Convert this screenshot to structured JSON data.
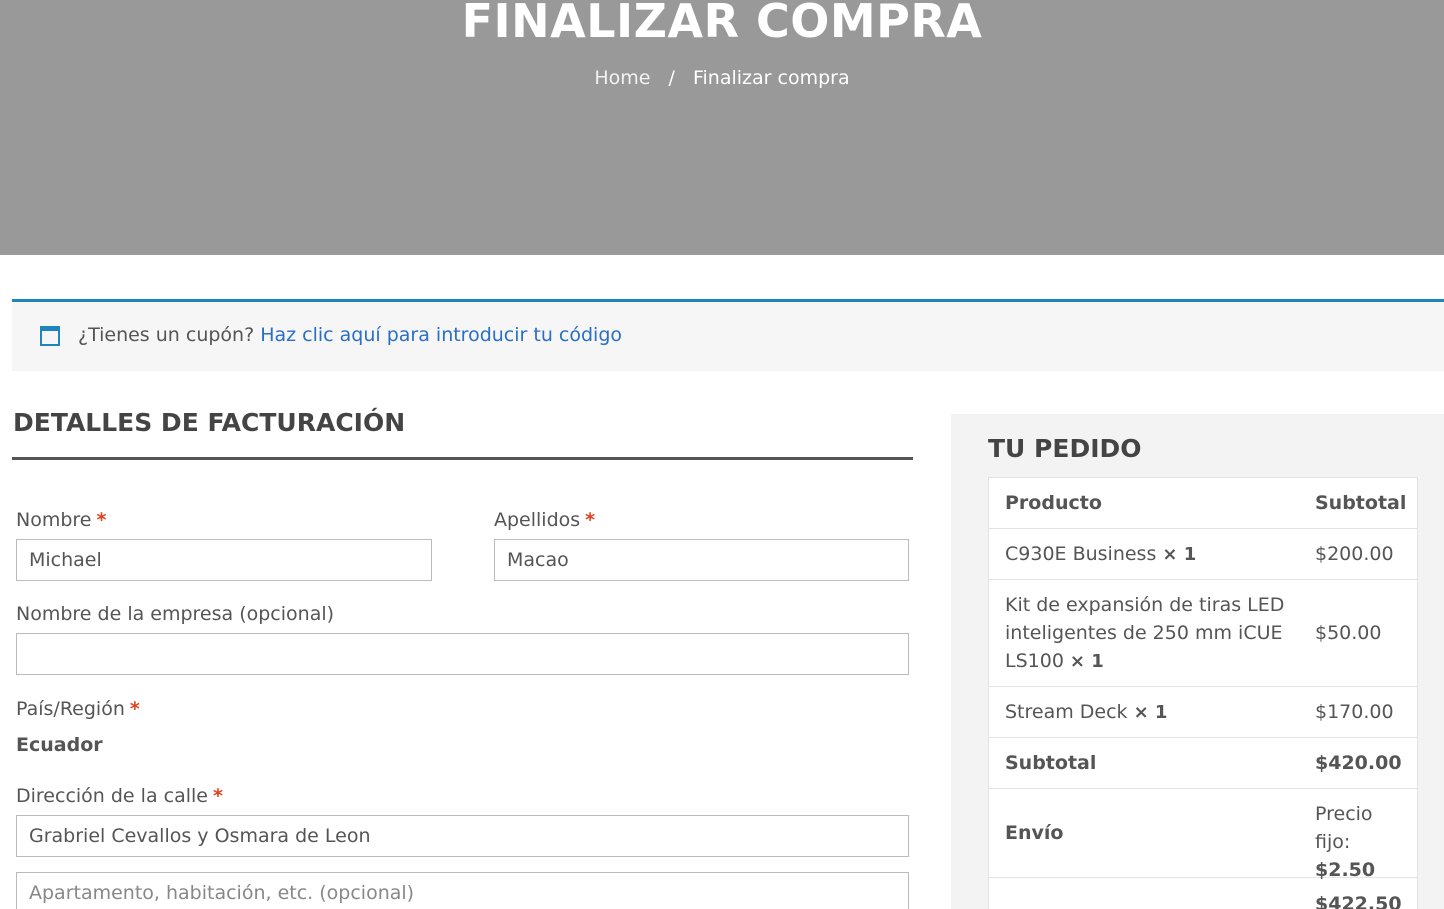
{
  "hero": {
    "title": "FINALIZAR COMPRA",
    "breadcrumb": {
      "home": "Home",
      "separator": "/",
      "current": "Finalizar compra"
    }
  },
  "coupon": {
    "question": "¿Tienes un cupón?",
    "link": "Haz clic aquí para introducir tu código"
  },
  "billing": {
    "title": "DETALLES DE FACTURACIÓN",
    "required_mark": "*",
    "first_name": {
      "label": "Nombre",
      "value": "Michael"
    },
    "last_name": {
      "label": "Apellidos",
      "value": "Macao"
    },
    "company": {
      "label": "Nombre de la empresa (opcional)",
      "value": ""
    },
    "country": {
      "label": "País/Región",
      "value": "Ecuador"
    },
    "street": {
      "label": "Dirección de la calle",
      "value": "Grabriel Cevallos y Osmara de Leon",
      "placeholder2": "Apartamento, habitación, etc. (opcional)"
    }
  },
  "order": {
    "title": "TU PEDIDO",
    "headers": {
      "product": "Producto",
      "subtotal": "Subtotal"
    },
    "items": [
      {
        "name": "C930E Business",
        "qty": "× 1",
        "price": "$200.00"
      },
      {
        "name_line1": "Kit de expansión de tiras LED",
        "name_line2": "inteligentes de 250 mm iCUE",
        "name_line3": "LS100",
        "qty": "× 1",
        "price": "$50.00"
      },
      {
        "name": "Stream Deck",
        "qty": "× 1",
        "price": "$170.00"
      }
    ],
    "subtotal": {
      "label": "Subtotal",
      "value": "$420.00"
    },
    "shipping": {
      "label": "Envío",
      "line1": "Precio",
      "line2_prefix": "fijo:",
      "amount": "$2.50"
    },
    "total": {
      "value": "$422.50"
    }
  },
  "colors": {
    "accent": "#1e85be",
    "link": "#2b6fc2",
    "required": "#e2401c",
    "hero_bg": "#999999"
  }
}
